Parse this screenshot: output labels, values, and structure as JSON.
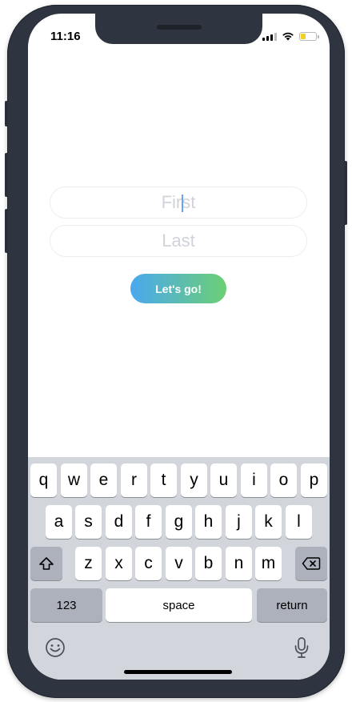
{
  "status_bar": {
    "time": "11:16",
    "battery_level": 0.35
  },
  "form": {
    "first_placeholder": "First",
    "last_placeholder": "Last",
    "submit_label": "Let's go!"
  },
  "keyboard": {
    "row1": [
      "q",
      "w",
      "e",
      "r",
      "t",
      "y",
      "u",
      "i",
      "o",
      "p"
    ],
    "row2": [
      "a",
      "s",
      "d",
      "f",
      "g",
      "h",
      "j",
      "k",
      "l"
    ],
    "row3": [
      "z",
      "x",
      "c",
      "v",
      "b",
      "n",
      "m"
    ],
    "numbers_label": "123",
    "space_label": "space",
    "return_label": "return"
  },
  "colors": {
    "gradient_start": "#4aa8f0",
    "gradient_end": "#6ccf74",
    "phone_frame": "#2e3440"
  },
  "icons": [
    "shift-icon",
    "backspace-icon",
    "emoji-icon",
    "microphone-icon",
    "signal-icon",
    "wifi-icon",
    "battery-icon"
  ]
}
